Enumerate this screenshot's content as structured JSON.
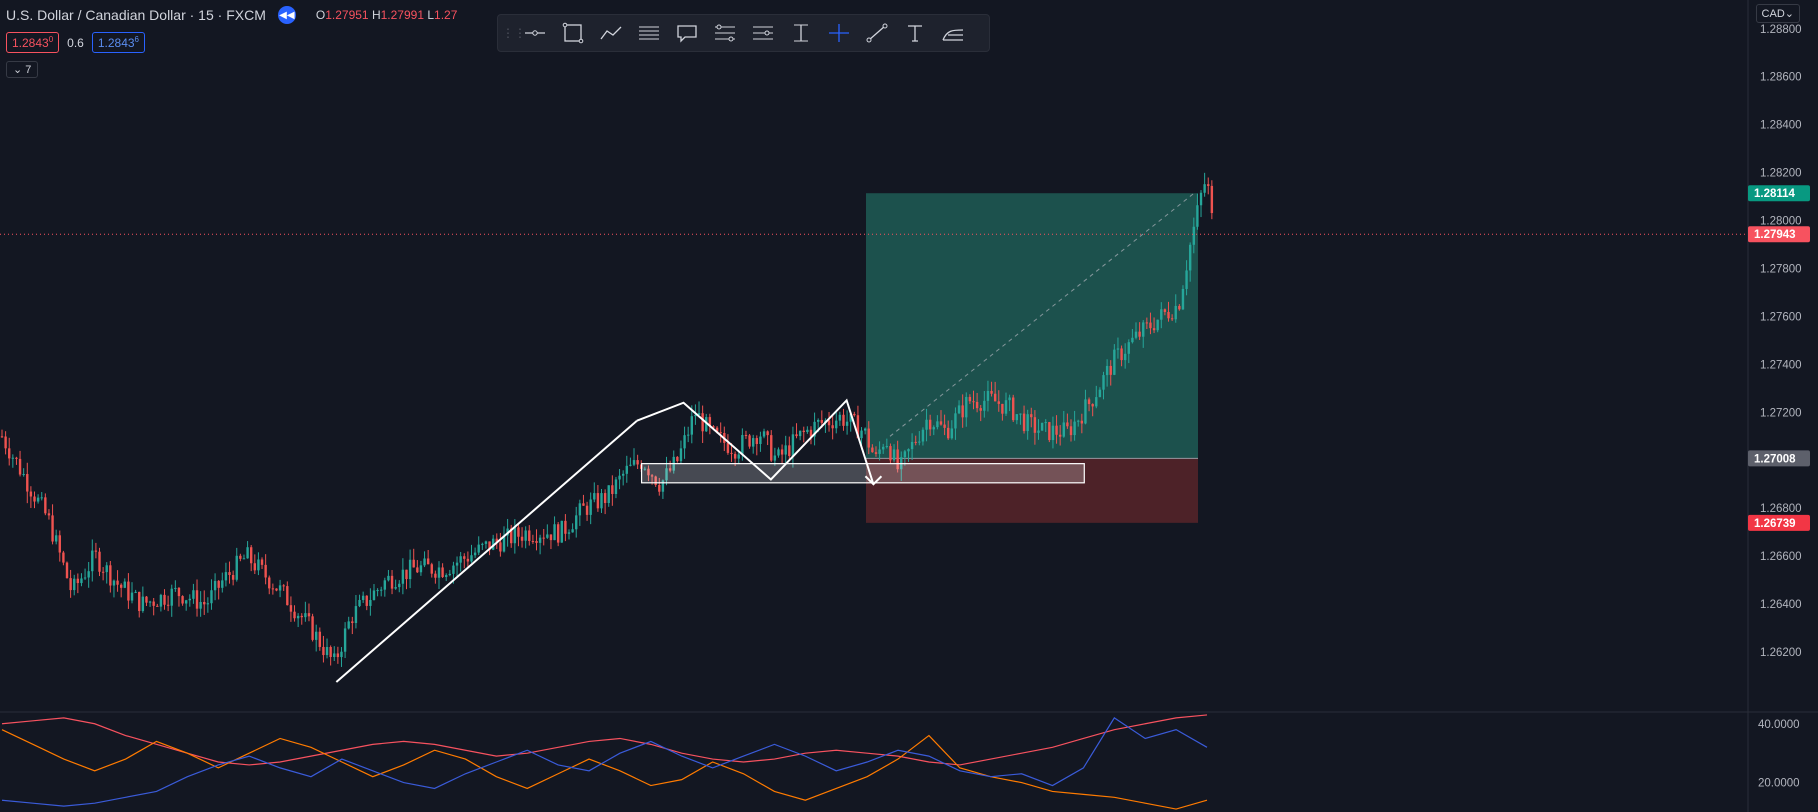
{
  "header": {
    "symbol": "U.S. Dollar / Canadian Dollar · 15 · FXCM",
    "ohlc_prefix_o": "O",
    "ohlc_o": "1.27951",
    "ohlc_prefix_h": "H",
    "ohlc_h": "1.27991",
    "ohlc_prefix_l": "L",
    "ohlc_l": "1.27"
  },
  "quote": {
    "bid": "1.2843",
    "bid_sup": "0",
    "spread": "0.6",
    "ask": "1.2843",
    "ask_sup": "6"
  },
  "indicators_badge": "7",
  "currency": "CAD",
  "toolbar": {
    "tools": [
      "horizontal-line-tool-icon",
      "rectangle-tool-icon",
      "path-tool-icon",
      "parallel-lines-tool-icon",
      "callout-tool-icon",
      "fib-retracement-tool-icon",
      "fib-extension-tool-icon",
      "price-range-tool-icon",
      "crosshair-tool-icon",
      "trend-line-tool-icon",
      "text-tool-icon",
      "pitchfork-tool-icon"
    ]
  },
  "colors": {
    "background": "#131722",
    "up": "#26a69a",
    "down": "#ef5350",
    "target_zone": "#1e5c55",
    "stop_zone": "#5c262b",
    "last_price": "#f7525f",
    "target_tag": "#089981",
    "entry_tag": "#5d606b",
    "stop_tag": "#f23645"
  },
  "chart_data": [
    {
      "type": "candlestick",
      "price_axis": {
        "ticks": [
          "1.28800",
          "1.28600",
          "1.28400",
          "1.28200",
          "1.28000",
          "1.27800",
          "1.27600",
          "1.27400",
          "1.27200",
          "1.26800",
          "1.26600",
          "1.26400",
          "1.26200"
        ],
        "ylim": [
          1.2595,
          1.2892
        ]
      },
      "price_tags": {
        "target": "1.28114",
        "last": "1.27943",
        "entry": "1.27008",
        "stop": "1.26739"
      },
      "position": {
        "entry": 1.27008,
        "target": 1.28114,
        "stop": 1.26739
      },
      "anchors": [
        [
          0,
          1.271
        ],
        [
          40,
          1.2675
        ],
        [
          60,
          1.2645
        ],
        [
          80,
          1.266
        ],
        [
          100,
          1.2648
        ],
        [
          120,
          1.264
        ],
        [
          150,
          1.2645
        ],
        [
          175,
          1.264
        ],
        [
          190,
          1.265
        ],
        [
          210,
          1.266
        ],
        [
          240,
          1.2645
        ],
        [
          265,
          1.263
        ],
        [
          285,
          1.2615
        ],
        [
          300,
          1.2635
        ],
        [
          330,
          1.265
        ],
        [
          355,
          1.2655
        ],
        [
          380,
          1.2655
        ],
        [
          400,
          1.266
        ],
        [
          420,
          1.2665
        ],
        [
          450,
          1.267
        ],
        [
          480,
          1.267
        ],
        [
          500,
          1.268
        ],
        [
          520,
          1.2685
        ],
        [
          535,
          1.2695
        ],
        [
          550,
          1.27
        ],
        [
          565,
          1.269
        ],
        [
          580,
          1.27
        ],
        [
          595,
          1.272
        ],
        [
          610,
          1.271
        ],
        [
          630,
          1.2705
        ],
        [
          650,
          1.2712
        ],
        [
          665,
          1.27
        ],
        [
          685,
          1.271
        ],
        [
          700,
          1.2715
        ],
        [
          720,
          1.2718
        ],
        [
          740,
          1.2712
        ],
        [
          750,
          1.27
        ],
        [
          758,
          1.271
        ],
        [
          770,
          1.2695
        ],
        [
          780,
          1.2705
        ],
        [
          795,
          1.2718
        ],
        [
          810,
          1.2712
        ],
        [
          830,
          1.2725
        ],
        [
          850,
          1.2725
        ],
        [
          865,
          1.2722
        ],
        [
          880,
          1.2715
        ],
        [
          895,
          1.2712
        ],
        [
          915,
          1.2712
        ],
        [
          935,
          1.2725
        ],
        [
          955,
          1.2742
        ],
        [
          975,
          1.2752
        ],
        [
          995,
          1.276
        ],
        [
          1010,
          1.2765
        ],
        [
          1020,
          1.279
        ],
        [
          1030,
          1.2812
        ],
        [
          1034,
          1.2818
        ],
        [
          1040,
          1.2795
        ]
      ],
      "path_annotations": [
        {
          "name": "rising-channel-line",
          "points": [
            [
              287,
              1.26075
            ],
            [
              545,
              1.27165
            ]
          ]
        },
        {
          "name": "double-top-pattern",
          "points": [
            [
              545,
              1.27165
            ],
            [
              585,
              1.2724
            ],
            [
              660,
              1.2692
            ],
            [
              725,
              1.2725
            ],
            [
              748,
              1.269
            ]
          ]
        }
      ],
      "consolidation_box": {
        "x": [
          549,
          929
        ],
        "y": [
          1.26906,
          1.26986
        ]
      }
    },
    {
      "type": "line",
      "name": "oscillator",
      "axis_ticks": [
        "40.0000",
        "20.0000"
      ],
      "ylim": [
        10,
        44
      ],
      "series": [
        {
          "color": "#f7525f",
          "values": [
            40,
            41,
            42,
            40,
            36,
            33,
            30,
            27,
            26,
            27,
            29,
            31,
            33,
            34,
            33,
            31,
            29,
            30,
            32,
            34,
            35,
            33,
            30,
            28,
            27,
            28,
            30,
            31,
            30,
            29,
            27,
            26,
            28,
            30,
            32,
            35,
            38,
            40,
            42,
            43
          ]
        },
        {
          "color": "#ff7b00",
          "values": [
            38,
            33,
            28,
            24,
            28,
            34,
            30,
            25,
            30,
            35,
            32,
            27,
            22,
            26,
            31,
            28,
            22,
            18,
            23,
            28,
            24,
            19,
            21,
            27,
            23,
            17,
            14,
            18,
            22,
            28,
            36,
            25,
            22,
            20,
            17,
            16,
            15,
            13,
            11,
            14
          ]
        },
        {
          "color": "#3a5bd9",
          "values": [
            14,
            13,
            12,
            13,
            15,
            17,
            22,
            26,
            29,
            25,
            22,
            28,
            24,
            20,
            18,
            23,
            27,
            31,
            26,
            24,
            30,
            34,
            29,
            25,
            29,
            33,
            29,
            24,
            27,
            31,
            29,
            24,
            22,
            23,
            19,
            25,
            42,
            35,
            38,
            32
          ]
        }
      ]
    }
  ]
}
